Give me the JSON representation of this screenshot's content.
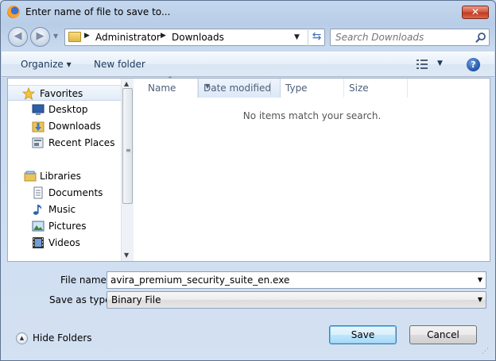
{
  "window": {
    "title": "Enter name of file to save to...",
    "close_glyph": "✕"
  },
  "nav": {
    "back_glyph": "◀",
    "forward_glyph": "▶",
    "history_dropdown_glyph": "▼"
  },
  "address": {
    "crumbs": [
      "Administrator",
      "Downloads"
    ],
    "crumb_arrow": "▶",
    "dropdown_glyph": "▼",
    "refresh_glyph": "⇆"
  },
  "search": {
    "placeholder": "Search Downloads"
  },
  "toolbar": {
    "organize_label": "Organize ▾",
    "new_folder_label": "New folder",
    "view_dropdown_glyph": "▼",
    "help_glyph": "?"
  },
  "sidebar": {
    "favorites_label": "Favorites",
    "favorites": [
      "Desktop",
      "Downloads",
      "Recent Places"
    ],
    "libraries_label": "Libraries",
    "libraries": [
      "Documents",
      "Music",
      "Pictures",
      "Videos"
    ]
  },
  "scrollbar": {
    "up_glyph": "▲",
    "down_glyph": "▼",
    "grip_glyph": "≡"
  },
  "columns": {
    "name": "Name",
    "date_modified": "Date modified",
    "type": "Type",
    "size": "Size",
    "sort_glyph": "^",
    "filter_glyph": "▼"
  },
  "file_list": {
    "empty_message": "No items match your search."
  },
  "form": {
    "file_name_label": "File name:",
    "file_name_value": "avira_premium_security_suite_en.exe",
    "save_as_type_label": "Save as type:",
    "save_as_type_value": "Binary File",
    "dropdown_glyph": "▼"
  },
  "footer": {
    "hide_folders_label": "Hide Folders",
    "hide_folders_glyph": "▲",
    "save_label": "Save",
    "cancel_label": "Cancel",
    "resize_glyph": "⋰"
  },
  "colors": {
    "link_blue": "#1e395b",
    "accent_blue": "#3c7fb1",
    "close_red": "#c0371d"
  }
}
